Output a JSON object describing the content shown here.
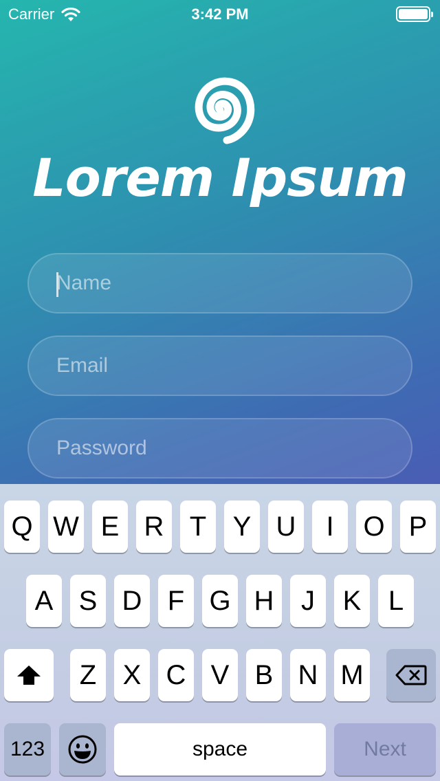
{
  "status_bar": {
    "carrier": "Carrier",
    "time": "3:42 PM",
    "wifi_icon": "wifi-icon",
    "battery_icon": "battery-icon"
  },
  "logo": {
    "icon": "spiral-icon",
    "text": "Lorem Ipsum"
  },
  "form": {
    "name_placeholder": "Name",
    "name_value": "",
    "email_placeholder": "Email",
    "email_value": "",
    "password_placeholder": "Password",
    "password_value": ""
  },
  "keyboard": {
    "row1": [
      "Q",
      "W",
      "E",
      "R",
      "T",
      "Y",
      "U",
      "I",
      "O",
      "P"
    ],
    "row2": [
      "A",
      "S",
      "D",
      "F",
      "G",
      "H",
      "J",
      "K",
      "L"
    ],
    "row3": [
      "Z",
      "X",
      "C",
      "V",
      "B",
      "N",
      "M"
    ],
    "shift_icon": "shift-icon",
    "delete_icon": "backspace-icon",
    "numbers_label": "123",
    "emoji_icon": "emoji-icon",
    "space_label": "space",
    "next_label": "Next"
  },
  "colors": {
    "gradient_start": "#25b6ae",
    "gradient_end": "#4a5db4",
    "keyboard_bg": "#c9d6e6",
    "next_key": "#a9aed7"
  }
}
